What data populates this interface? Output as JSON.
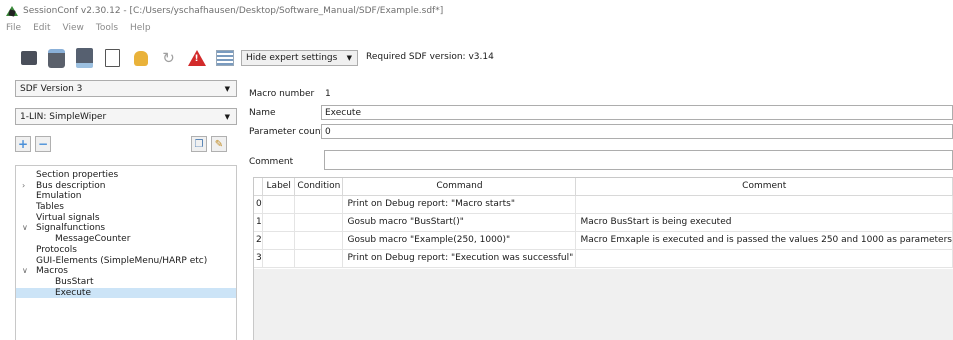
{
  "window": {
    "title": "SessionConf v2.30.12 - [C:/Users/yschafhausen/Desktop/Software_Manual/SDF/Example.sdf*]"
  },
  "menu": [
    "File",
    "Edit",
    "View",
    "Tools",
    "Help"
  ],
  "toolbar": {
    "icons": [
      "new-document-icon",
      "open-icon",
      "save-icon",
      "blank-page-icon",
      "hand-icon",
      "refresh-icon",
      "warning-icon",
      "list-icon"
    ],
    "expert_settings": "Hide expert settings",
    "required_version": "Required SDF version: v3.14"
  },
  "sidebar": {
    "sdf_version": "SDF Version 3",
    "lin_select": "1-LIN: SimpleWiper",
    "add_label": "+",
    "remove_label": "−",
    "tree": [
      {
        "label": "Section properties",
        "level": 0,
        "caret": ""
      },
      {
        "label": "Bus description",
        "level": 0,
        "caret": "›"
      },
      {
        "label": "Emulation",
        "level": 0,
        "caret": ""
      },
      {
        "label": "Tables",
        "level": 0,
        "caret": ""
      },
      {
        "label": "Virtual signals",
        "level": 0,
        "caret": ""
      },
      {
        "label": "Signalfunctions",
        "level": 0,
        "caret": "∨"
      },
      {
        "label": "MessageCounter",
        "level": 1,
        "caret": ""
      },
      {
        "label": "Protocols",
        "level": 0,
        "caret": ""
      },
      {
        "label": "GUI-Elements (SimpleMenu/HARP etc)",
        "level": 0,
        "caret": ""
      },
      {
        "label": "Macros",
        "level": 0,
        "caret": "∨"
      },
      {
        "label": "BusStart",
        "level": 1,
        "caret": ""
      },
      {
        "label": "Execute",
        "level": 1,
        "caret": "",
        "selected": true
      }
    ]
  },
  "macro": {
    "number_label": "Macro number",
    "number_value": "1",
    "name_label": "Name",
    "name_value": "Execute",
    "param_label": "Parameter count",
    "param_value": "0",
    "comment_label": "Comment",
    "comment_value": ""
  },
  "table": {
    "headers": [
      "",
      "Label",
      "Condition",
      "Command",
      "Comment"
    ],
    "rows": [
      {
        "index": "0",
        "label": "",
        "condition": "",
        "command": "Print on Debug report: \"Macro starts\"",
        "comment": ""
      },
      {
        "index": "1",
        "label": "",
        "condition": "",
        "command": "Gosub macro \"BusStart()\"",
        "comment": "Macro BusStart is being executed"
      },
      {
        "index": "2",
        "label": "",
        "condition": "",
        "command": "Gosub macro \"Example(250, 1000)\"",
        "comment": "Macro Emxaple is executed and is passed the values 250 and 1000 as parameters"
      },
      {
        "index": "3",
        "label": "",
        "condition": "",
        "command": "Print on Debug report: \"Execution was successful\"",
        "comment": ""
      }
    ]
  }
}
